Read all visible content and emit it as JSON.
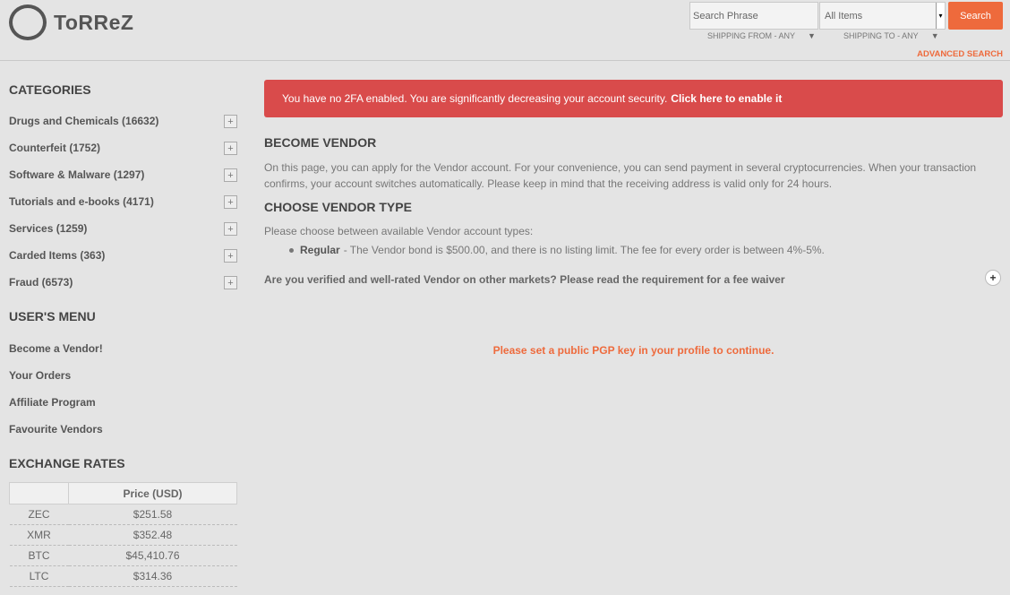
{
  "brand": {
    "logo_text": "ToRReZ"
  },
  "header": {
    "search_placeholder": "Search Phrase",
    "category_select": "All Items",
    "search_button": "Search",
    "shipping_from": "SHIPPING FROM - ANY",
    "shipping_to": "SHIPPING TO - ANY",
    "advanced_search": "ADVANCED SEARCH"
  },
  "sidebar": {
    "categories_title": "CATEGORIES",
    "categories": [
      "Drugs and Chemicals (16632)",
      "Counterfeit (1752)",
      "Software & Malware (1297)",
      "Tutorials and e-books (4171)",
      "Services (1259)",
      "Carded Items (363)",
      "Fraud (6573)"
    ],
    "expand_symbol": "+",
    "user_menu_title": "USER'S MENU",
    "user_menu": [
      "Become a Vendor!",
      "Your Orders",
      "Affiliate Program",
      "Favourite Vendors"
    ],
    "exchange_title": "EXCHANGE RATES",
    "exchange_header": "Price (USD)",
    "rates": [
      {
        "coin": "ZEC",
        "price": "$251.58"
      },
      {
        "coin": "XMR",
        "price": "$352.48"
      },
      {
        "coin": "BTC",
        "price": "$45,410.76"
      },
      {
        "coin": "LTC",
        "price": "$314.36"
      }
    ]
  },
  "main": {
    "alert_text": "You have no 2FA enabled. You are significantly decreasing your account security.",
    "alert_link": "Click here to enable it",
    "become_title": "BECOME VENDOR",
    "become_text": "On this page, you can apply for the Vendor account. For your convenience, you can send payment in several cryptocurrencies. When your transaction confirms, your account switches automatically. Please keep in mind that the receiving address is valid only for 24 hours.",
    "choose_title": "CHOOSE VENDOR TYPE",
    "choose_text": "Please choose between available Vendor account types:",
    "type_name": "Regular",
    "type_desc": "- The Vendor bond is $500.00, and there is no listing limit. The fee for every order is between 4%-5%.",
    "waiver_text": "Are you verified and well-rated Vendor on other markets? Please read the requirement for a fee waiver",
    "waiver_symbol": "+",
    "pgp_message": "Please set a public PGP key in your profile to continue."
  },
  "colors": {
    "accent": "#ee6a3c",
    "alert": "#d94b4b",
    "background": "#e4e4e4"
  },
  "icons": {
    "dropdown": "triangle-down-icon",
    "expand": "plus-icon"
  }
}
